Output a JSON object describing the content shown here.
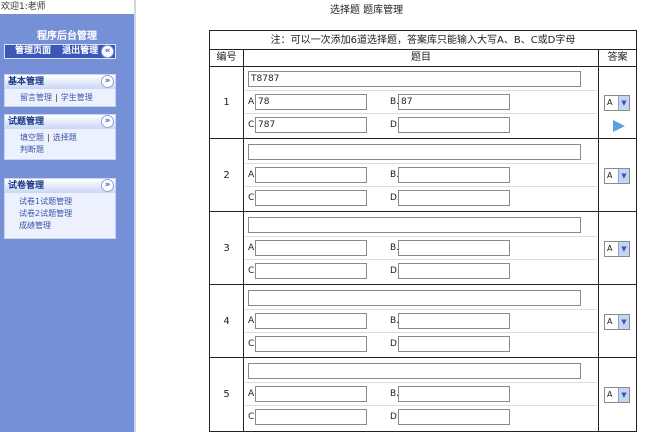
{
  "sidebar": {
    "welcome": "欢迎1:老师",
    "title": "程序后台管理",
    "top_links": [
      "管理页面",
      "退出管理"
    ],
    "collapse_icon": "double-chevron-left-icon",
    "groups": [
      {
        "title": "基本管理",
        "items": [
          "留言管理",
          "学生管理"
        ]
      },
      {
        "title": "试题管理",
        "items": [
          "填空题",
          "选择题",
          "判断题"
        ]
      },
      {
        "title": "试卷管理",
        "items": [
          "试卷1试题管理",
          "试卷2试题管理",
          "成绩管理"
        ]
      }
    ]
  },
  "page": {
    "title": "选择题 题库管理",
    "note": "注：可以一次添加6道选择题，答案库只能输入大写A、B、C或D字母",
    "headers": [
      "编号",
      "题目",
      "答案"
    ]
  },
  "questions": [
    {
      "num": "1",
      "stem": "T8787",
      "A": "78",
      "B": "87",
      "C": "787",
      "D": "",
      "answer": "A"
    },
    {
      "num": "2",
      "stem": "",
      "A": "",
      "B": "",
      "C": "",
      "D": "",
      "answer": "A"
    },
    {
      "num": "3",
      "stem": "",
      "A": "",
      "B": "",
      "C": "",
      "D": "",
      "answer": "A"
    },
    {
      "num": "4",
      "stem": "",
      "A": "",
      "B": "",
      "C": "",
      "D": "",
      "answer": "A"
    },
    {
      "num": "5",
      "stem": "",
      "A": "",
      "B": "",
      "C": "",
      "D": "",
      "answer": "A"
    }
  ],
  "option_labels": {
    "a": "A.",
    "b": "B.",
    "c": "C.",
    "d": "D."
  },
  "colors": {
    "sidebar": "#7590d6",
    "sidebar_dark": "#3b58b8",
    "border": "#222222"
  }
}
